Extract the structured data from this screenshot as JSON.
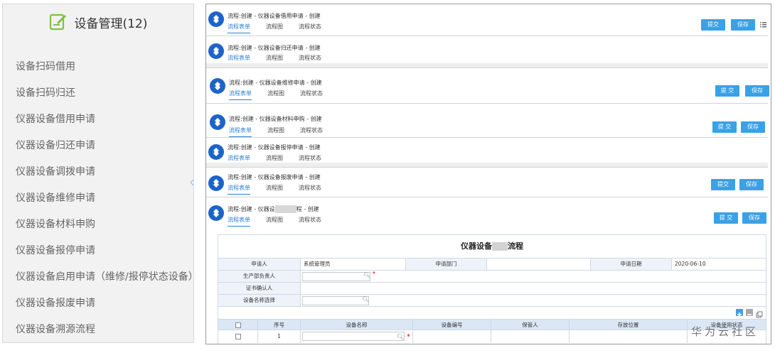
{
  "sidebar": {
    "title": "设备管理(12)",
    "icon": "edit-note-icon",
    "items": [
      {
        "label": "设备扫码借用"
      },
      {
        "label": "设备扫码归还"
      },
      {
        "label": "仪器设备借用申请"
      },
      {
        "label": "仪器设备归还申请"
      },
      {
        "label": "仪器设备调拨申请"
      },
      {
        "label": "仪器设备维修申请"
      },
      {
        "label": "仪器设备材料申购"
      },
      {
        "label": "仪器设备报停申请"
      },
      {
        "label": "仪器设备启用申请（维修/报停状态设备）"
      },
      {
        "label": "仪器设备报废申请"
      },
      {
        "label": "仪器设备溯源流程"
      }
    ]
  },
  "flows": [
    {
      "title": "流程:创建 - 仪器设备借用申请 - 创建",
      "tabs": [
        "流程表单",
        "流程图",
        "流程状态"
      ],
      "submit": "提交",
      "save": "保存"
    },
    {
      "title": "流程:创建 - 仪器设备归还申请 - 创建",
      "tabs": [
        "流程表单",
        "流程图",
        "流程状态"
      ]
    },
    {
      "title": "流程:创建 - 仪器设备维修申请 - 创建",
      "tabs": [
        "流程表单",
        "流程图",
        "流程状态"
      ],
      "submit": "提 交",
      "save": "保存"
    },
    {
      "title": "流程:创建 - 仪器设备材料申购 - 创建",
      "tabs": [
        "流程表单",
        "流程图",
        "流程状态"
      ],
      "submit": "提 交",
      "save": "保存"
    },
    {
      "title": "流程:创建 - 仪器设备报停申请 - 创建",
      "tabs": [
        "流程表单",
        "流程图",
        "流程状态"
      ]
    },
    {
      "title": "流程:创建 - 仪器设备报废申请 - 创建",
      "tabs": [
        "流程表单",
        "流程图",
        "流程状态"
      ],
      "submit": "提交",
      "save": "保存"
    },
    {
      "title_prefix": "流程:创建 - 仪器设",
      "title_suffix": "程 - 创建",
      "tabs": [
        "流程表单",
        "流程图",
        "流程状态"
      ],
      "submit": "提 交",
      "save": "保存"
    }
  ],
  "form": {
    "title_prefix": "仪器设备",
    "title_suffix": "流程",
    "applicant_label": "申请人",
    "applicant_value": "系统管理员",
    "dept_label": "申请部门",
    "dept_value": "",
    "date_label": "申请日期",
    "date_value": "2020-06-10",
    "prod_label": "生产部负责人",
    "cert_label": "证书确认人",
    "device_select_label": "设备名称选择",
    "required_mark": "*",
    "table": {
      "headers": [
        "序号",
        "设备名称",
        "设备编号",
        "保管人",
        "存放位置",
        "设备使用状态"
      ],
      "rows": [
        {
          "seq": "1",
          "name": "",
          "code": "",
          "keeper": "",
          "location": "",
          "status": ""
        }
      ]
    }
  },
  "watermark": "华为云社区",
  "colors": {
    "accent": "#3aa1e6",
    "logo": "#1c64c8",
    "header_bg": "#dbe7f5",
    "label_bg": "#eef3f9"
  }
}
